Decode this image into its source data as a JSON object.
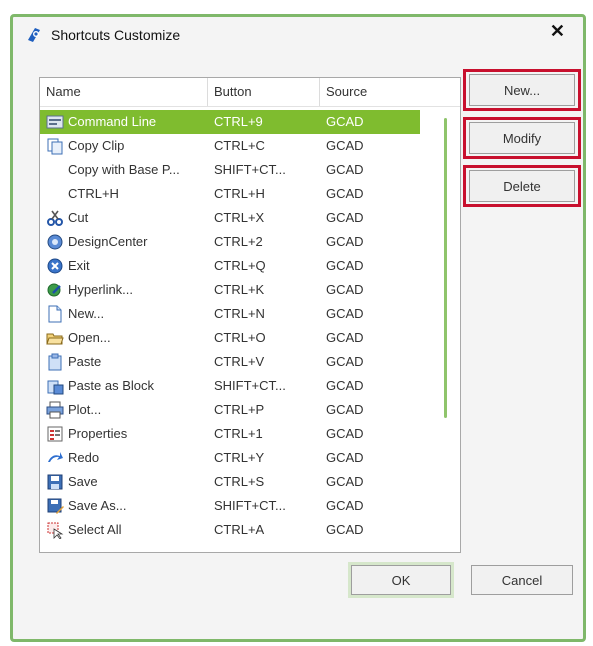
{
  "window": {
    "title": "Shortcuts Customize"
  },
  "columns": {
    "name": "Name",
    "button": "Button",
    "source": "Source"
  },
  "rows": [
    {
      "name": "Command Line",
      "button": "CTRL+9",
      "source": "GCAD",
      "icon": "command-line-icon",
      "selected": true
    },
    {
      "name": "Copy Clip",
      "button": "CTRL+C",
      "source": "GCAD",
      "icon": "copy-icon"
    },
    {
      "name": "Copy with Base P...",
      "button": "SHIFT+CT...",
      "source": "GCAD",
      "icon": ""
    },
    {
      "name": "CTRL+H",
      "button": "CTRL+H",
      "source": "GCAD",
      "icon": ""
    },
    {
      "name": "Cut",
      "button": "CTRL+X",
      "source": "GCAD",
      "icon": "scissors-icon"
    },
    {
      "name": "DesignCenter",
      "button": "CTRL+2",
      "source": "GCAD",
      "icon": "design-center-icon"
    },
    {
      "name": "Exit",
      "button": "CTRL+Q",
      "source": "GCAD",
      "icon": "exit-icon"
    },
    {
      "name": "Hyperlink...",
      "button": "CTRL+K",
      "source": "GCAD",
      "icon": "hyperlink-icon"
    },
    {
      "name": "New...",
      "button": "CTRL+N",
      "source": "GCAD",
      "icon": "new-document-icon"
    },
    {
      "name": "Open...",
      "button": "CTRL+O",
      "source": "GCAD",
      "icon": "open-folder-icon"
    },
    {
      "name": "Paste",
      "button": "CTRL+V",
      "source": "GCAD",
      "icon": "paste-icon"
    },
    {
      "name": "Paste as Block",
      "button": "SHIFT+CT...",
      "source": "GCAD",
      "icon": "paste-block-icon"
    },
    {
      "name": "Plot...",
      "button": "CTRL+P",
      "source": "GCAD",
      "icon": "printer-icon"
    },
    {
      "name": "Properties",
      "button": "CTRL+1",
      "source": "GCAD",
      "icon": "properties-icon"
    },
    {
      "name": "Redo",
      "button": "CTRL+Y",
      "source": "GCAD",
      "icon": "redo-icon"
    },
    {
      "name": "Save",
      "button": "CTRL+S",
      "source": "GCAD",
      "icon": "save-icon"
    },
    {
      "name": "Save As...",
      "button": "SHIFT+CT...",
      "source": "GCAD",
      "icon": "save-as-icon"
    },
    {
      "name": "Select All",
      "button": "CTRL+A",
      "source": "GCAD",
      "icon": "select-all-icon"
    }
  ],
  "side_buttons": {
    "new": "New...",
    "modify": "Modify",
    "delete": "Delete"
  },
  "footer": {
    "ok": "OK",
    "cancel": "Cancel"
  },
  "colors": {
    "selection": "#7fbc2f",
    "highlight_border": "#c8102e",
    "window_border": "#7fb86a"
  }
}
